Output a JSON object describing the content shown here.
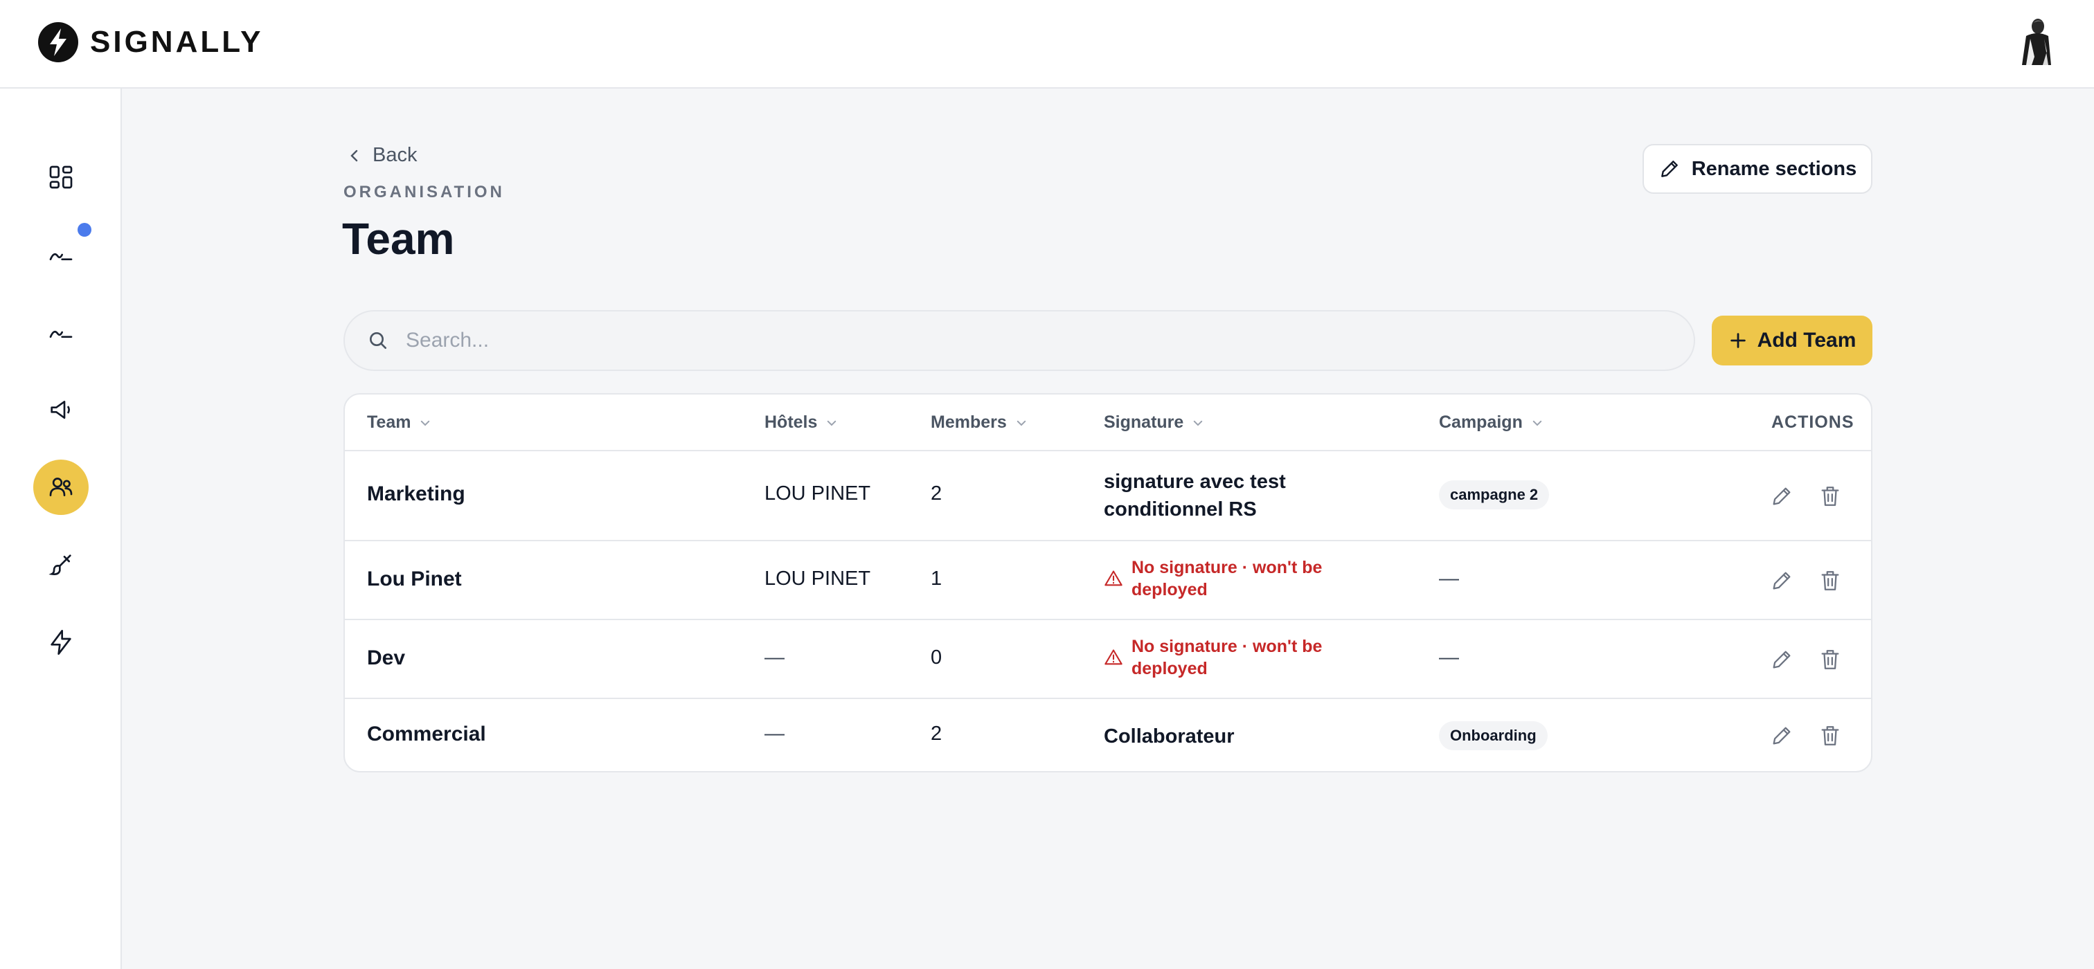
{
  "brand": {
    "name": "SIGNALLY"
  },
  "header": {
    "back_label": "Back",
    "eyebrow": "ORGANISATION",
    "title": "Team",
    "rename_label": "Rename sections"
  },
  "search": {
    "placeholder": "Search...",
    "value": ""
  },
  "add_button": {
    "label": "Add Team"
  },
  "sidebar": {
    "items": [
      {
        "icon": "dashboard-grid-icon",
        "active": false
      },
      {
        "icon": "signature-icon",
        "active": false,
        "notification": true
      },
      {
        "icon": "signature-icon",
        "active": false
      },
      {
        "icon": "megaphone-icon",
        "active": false
      },
      {
        "icon": "users-icon",
        "active": true
      },
      {
        "icon": "paint-brush-icon",
        "active": false
      },
      {
        "icon": "lightning-icon",
        "active": false
      }
    ]
  },
  "table": {
    "columns": [
      "Team",
      "Hôtels",
      "Members",
      "Signature",
      "Campaign",
      "ACTIONS"
    ],
    "rows": [
      {
        "team": "Marketing",
        "hotels": "LOU PINET",
        "members": "2",
        "signature": "signature avec test conditionnel RS",
        "signature_missing": false,
        "campaign": "campagne 2"
      },
      {
        "team": "Lou Pinet",
        "hotels": "LOU PINET",
        "members": "1",
        "signature": "No signature · won't be deployed",
        "signature_missing": true,
        "campaign": "—"
      },
      {
        "team": "Dev",
        "hotels": "—",
        "members": "0",
        "signature": "No signature · won't be deployed",
        "signature_missing": true,
        "campaign": "—"
      },
      {
        "team": "Commercial",
        "hotels": "—",
        "members": "2",
        "signature": "Collaborateur",
        "signature_missing": false,
        "campaign": "Onboarding"
      }
    ]
  },
  "colors": {
    "accent": "#eec64a",
    "warning": "#c62828",
    "notification": "#4b7bec"
  }
}
